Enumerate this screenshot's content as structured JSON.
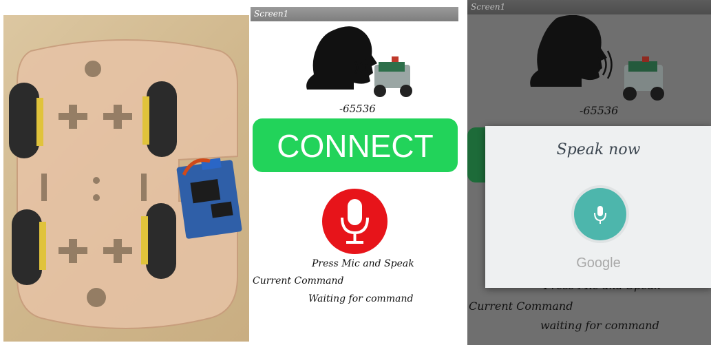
{
  "screen1": {
    "title": "Screen1",
    "value": "-65536",
    "connect_label": "CONNECT",
    "press_label": "Press Mic and Speak",
    "current_command_label": "Current Command",
    "status_text": "Waiting for command"
  },
  "screen2": {
    "title": "Screen1",
    "value": "-65536",
    "press_label": "Press Mic and Speak",
    "current_command_label": "Current Command",
    "status_text": "waiting for command",
    "dialog": {
      "prompt": "Speak now",
      "provider": "Google"
    }
  },
  "colors": {
    "connect_green": "#22d35a",
    "mic_red": "#e7141a",
    "google_mic_teal": "#4db6ac"
  },
  "icons": [
    "speaking-head-icon",
    "sound-waves-icon",
    "robot-car-icon",
    "microphone-icon"
  ]
}
